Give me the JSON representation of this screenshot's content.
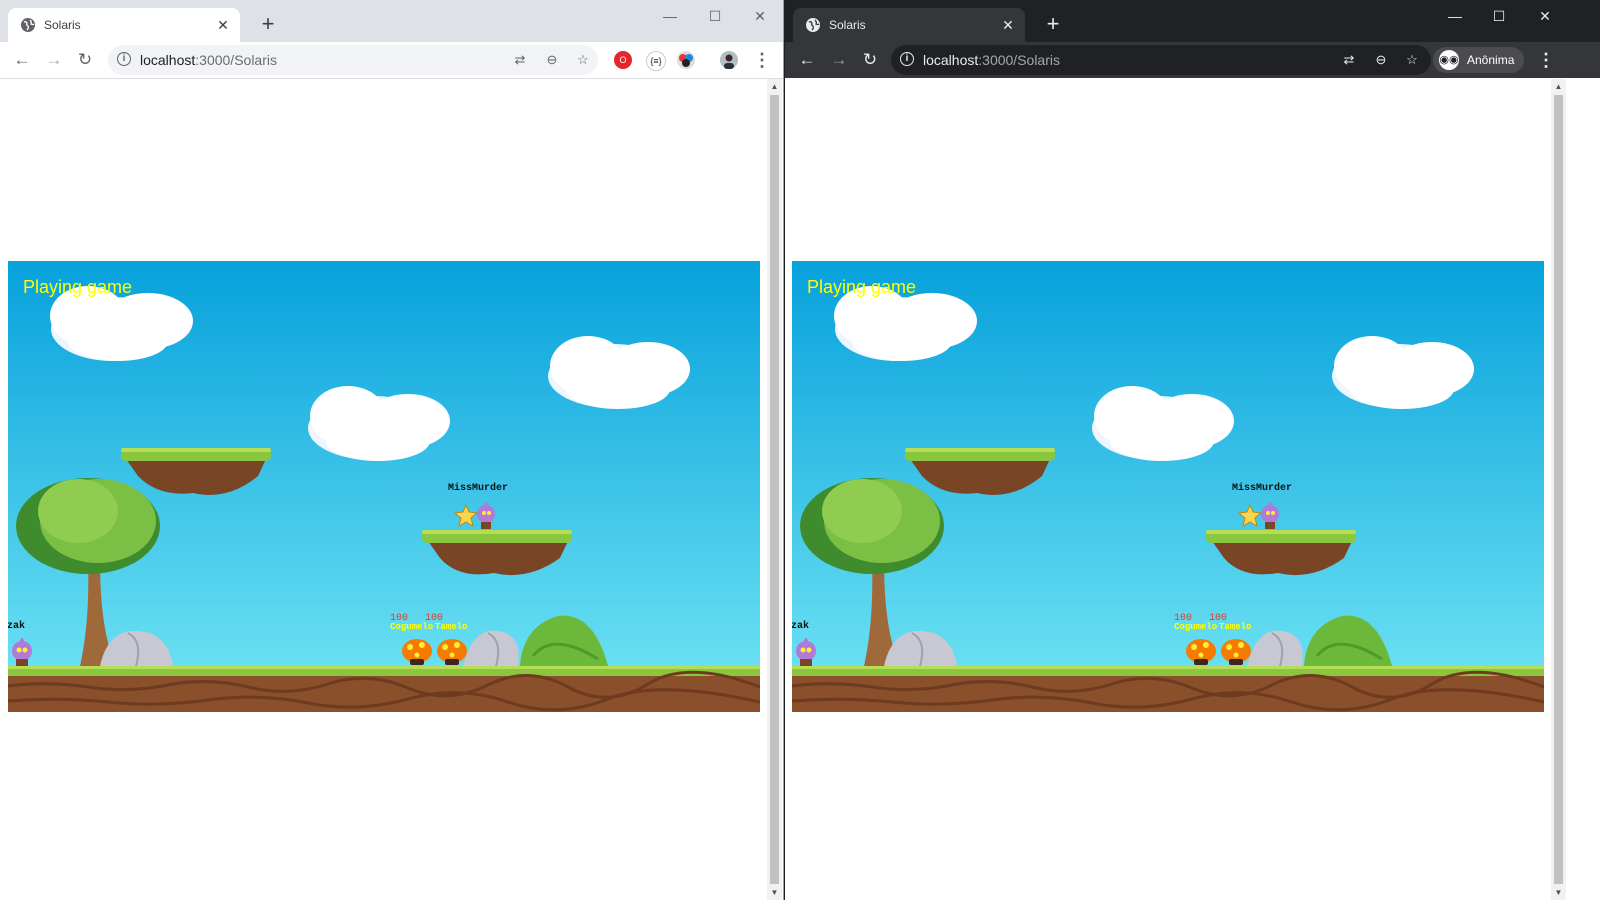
{
  "windows": [
    {
      "theme": "light",
      "tab": {
        "title": "Solaris"
      },
      "url": {
        "host": "localhost",
        "path": ":3000/Solaris"
      },
      "profile": {
        "icon": "profile-avatar-icon"
      }
    },
    {
      "theme": "dark",
      "tab": {
        "title": "Solaris"
      },
      "url": {
        "host": "localhost",
        "path": ":3000/Solaris"
      },
      "profile": {
        "label": "Anônima",
        "icon": "incognito-icon"
      }
    }
  ],
  "game": {
    "status_text": "Playing game",
    "players": [
      {
        "name": "MissMurder"
      },
      {
        "name": "azak"
      }
    ],
    "monsters": [
      {
        "name": "Cogumelo",
        "hp": "100"
      },
      {
        "name": "Tamelo",
        "hp": "100"
      }
    ],
    "colors": {
      "status_text": "#ffff00",
      "sky_top": "#07a1dc",
      "sky_bottom": "#73e6f4",
      "grass": "#8bc63f",
      "dirt": "#8a4f2b",
      "hp_text": "#e03b24",
      "monster_name": "#ffff00"
    }
  }
}
